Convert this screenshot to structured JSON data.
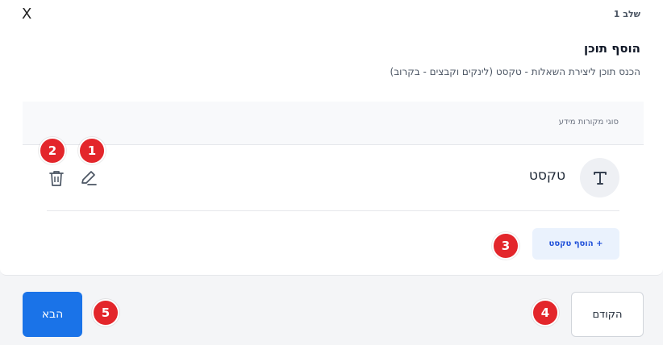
{
  "header": {
    "close_label": "X",
    "step_label": "שלב 1",
    "title": "הוסף תוכן",
    "subtitle": "הכנס תוכן ליצירת השאלות - טקסט (לינקים וקבצים - בקרוב)"
  },
  "sources_table": {
    "header": "סוגי מקורות מידע",
    "rows": [
      {
        "label": "טקסט",
        "icon": "text-type-icon"
      }
    ],
    "row_actions": {
      "edit_icon": "pencil-icon",
      "delete_icon": "trash-icon"
    },
    "add_button_label": "+ הוסף טקסט"
  },
  "footer": {
    "next_label": "הבא",
    "prev_label": "הקודם"
  },
  "badges": [
    "1",
    "2",
    "3",
    "4",
    "5"
  ],
  "colors": {
    "primary": "#1a73e8",
    "badge": "#e3262b",
    "add_button_bg": "#eaf2fd",
    "page_bg": "#f4f5f7"
  }
}
